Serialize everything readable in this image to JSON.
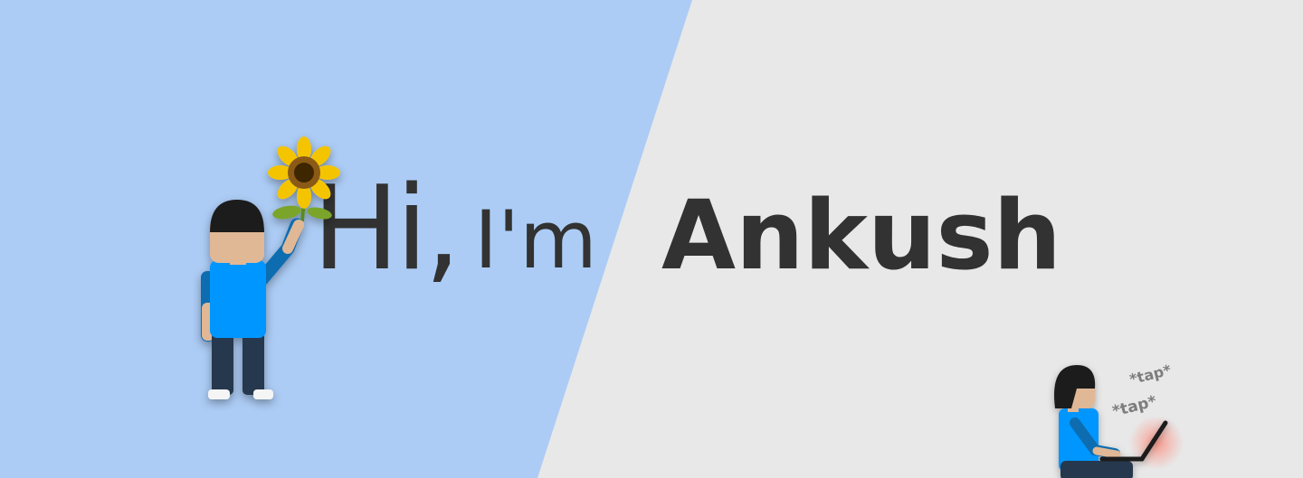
{
  "headline": {
    "hi": "Hi,",
    "im": "I'm",
    "name": "Ankush"
  },
  "taps": [
    "*tap*",
    "*tap*"
  ],
  "colors": {
    "left_panel": "#acccf5",
    "right_panel": "#e8e8e8",
    "text": "#323232",
    "shirt": "#0096ff",
    "skin": "#e0b896"
  },
  "icons": {
    "left": "person-holding-sunflower-illustration",
    "right": "person-typing-laptop-illustration"
  }
}
